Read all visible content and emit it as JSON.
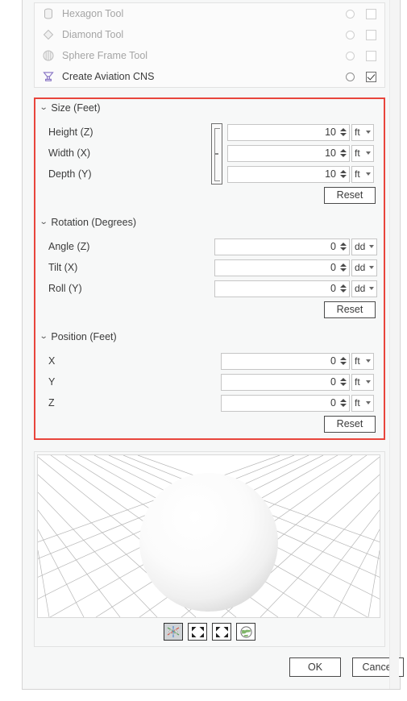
{
  "dialog": {
    "tool_list": [
      {
        "label": "Hexagon Tool",
        "icon": "hexagon-prism-icon",
        "enabled": false,
        "radio_selected": false,
        "checked": false
      },
      {
        "label": "Diamond Tool",
        "icon": "diamond-icon",
        "enabled": false,
        "radio_selected": false,
        "checked": false
      },
      {
        "label": "Sphere Frame Tool",
        "icon": "sphere-frame-icon",
        "enabled": false,
        "radio_selected": false,
        "checked": false
      },
      {
        "label": "Create Aviation CNS",
        "icon": "aviation-cns-icon",
        "enabled": true,
        "radio_selected": false,
        "checked": true
      }
    ],
    "sections": [
      {
        "title": "Size (Feet)",
        "expanded": true,
        "linked": true,
        "reset_label": "Reset",
        "rows": [
          {
            "label": "Height (Z)",
            "value": "10",
            "unit": "ft"
          },
          {
            "label": "Width (X)",
            "value": "10",
            "unit": "ft"
          },
          {
            "label": "Depth (Y)",
            "value": "10",
            "unit": "ft"
          }
        ]
      },
      {
        "title": "Rotation (Degrees)",
        "expanded": true,
        "linked": false,
        "reset_label": "Reset",
        "rows": [
          {
            "label": "Angle (Z)",
            "value": "0",
            "unit": "dd"
          },
          {
            "label": "Tilt (X)",
            "value": "0",
            "unit": "dd"
          },
          {
            "label": "Roll (Y)",
            "value": "0",
            "unit": "dd"
          }
        ]
      },
      {
        "title": "Position (Feet)",
        "expanded": true,
        "linked": false,
        "reset_label": "Reset",
        "rows": [
          {
            "label": "X",
            "value": "0",
            "unit": "ft"
          },
          {
            "label": "Y",
            "value": "0",
            "unit": "ft"
          },
          {
            "label": "Z",
            "value": "0",
            "unit": "ft"
          }
        ]
      }
    ],
    "viewport": {
      "shape": "sphere",
      "grid": "perspective-grid",
      "toolbar": [
        {
          "name": "axes-toggle-icon",
          "selected": true
        },
        {
          "name": "zoom-in-icon",
          "selected": false
        },
        {
          "name": "zoom-extents-icon",
          "selected": false
        },
        {
          "name": "globe-icon",
          "selected": false
        }
      ]
    },
    "footer": {
      "ok_label": "OK",
      "cancel_label": "Cancel"
    },
    "colors": {
      "annotation_red": "#e8453c",
      "accent_purple": "#8c79c6",
      "panel_bg": "#f6f7f7",
      "field_bg": "#ffffff"
    }
  }
}
